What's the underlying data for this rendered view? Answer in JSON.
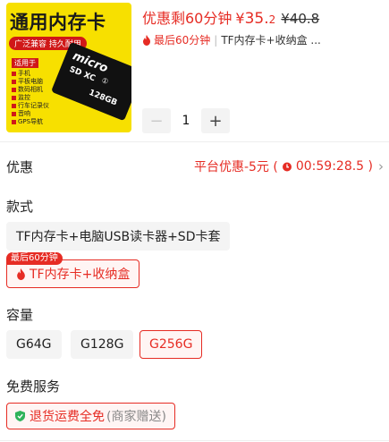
{
  "product": {
    "image": {
      "title": "通用内存卡",
      "badge": "广泛兼容 持久耐用",
      "apply_label": "适用于",
      "uses": [
        "手机",
        "平板电脑",
        "数码相机",
        "监控",
        "行车记录仪",
        "音响",
        "GPS导航"
      ],
      "card_brand": "micro",
      "card_xc": "SD XC",
      "card_capacity": "128GB",
      "card_grade": "①"
    },
    "price_tag": "优惠剩60分钟",
    "currency": "¥",
    "price_int": "35.",
    "price_dec": "2",
    "price_orig": "¥40.8",
    "promo_tag": "最后60分钟",
    "promo_sep": "|",
    "selected_summary": "TF内存卡+收纳盒 ...",
    "quantity": "1",
    "minus_label": "−",
    "plus_label": "+"
  },
  "discount": {
    "label": "优惠",
    "text": "平台优惠-5元 (",
    "timer": "00:59:28.5 )",
    "chevron": "›"
  },
  "style": {
    "label": "款式",
    "options": [
      "TF内存卡+电脑USB读卡器+SD卡套",
      "TF内存卡+收纳盒"
    ],
    "badge": "最后60分钟"
  },
  "capacity": {
    "label": "容量",
    "options": [
      "G64G",
      "G128G",
      "G256G"
    ],
    "selected": "G256G"
  },
  "service": {
    "label": "免费服务",
    "main": "退货运费全免",
    "sub": "(商家赠送)"
  },
  "colors": {
    "accent": "#e62c24",
    "image_bg": "#f7e000"
  }
}
